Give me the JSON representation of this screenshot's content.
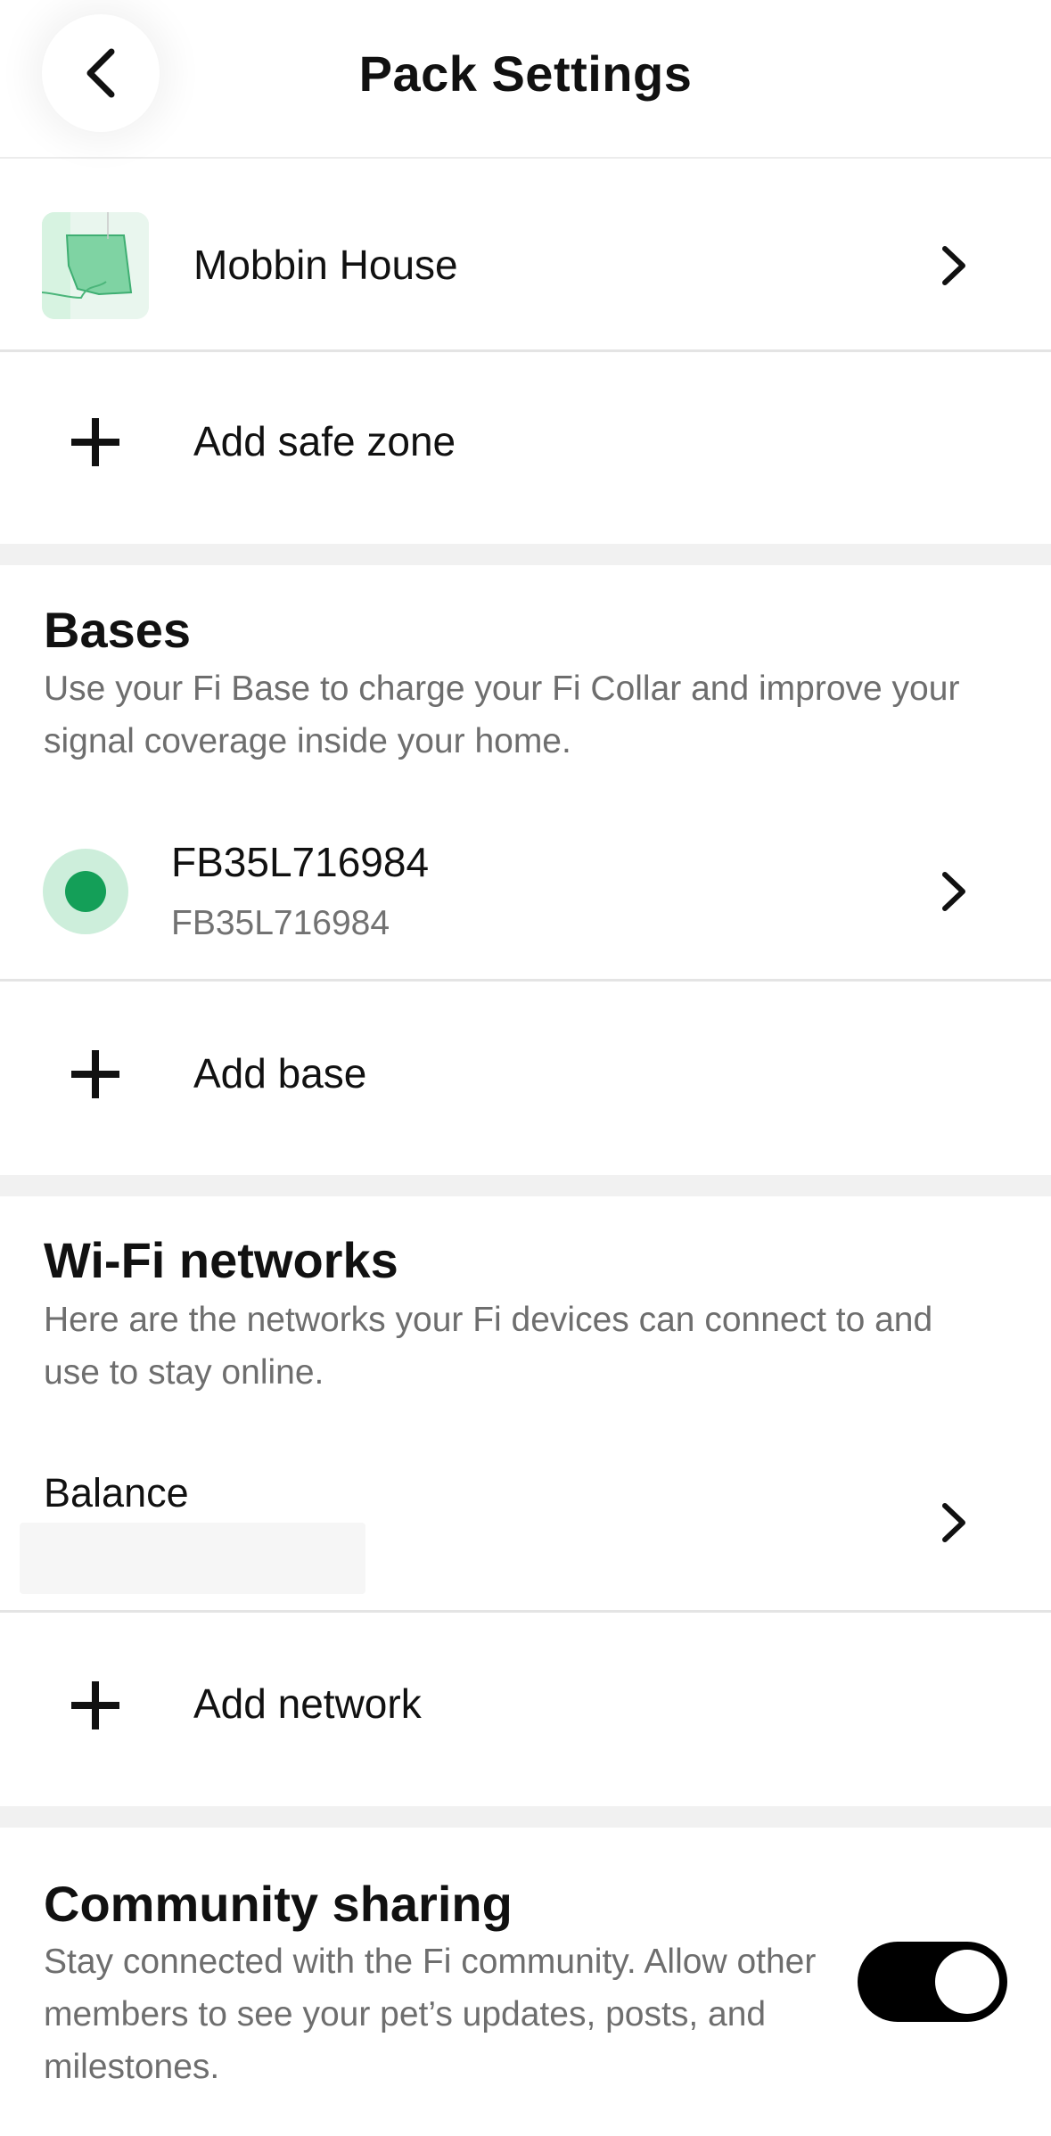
{
  "header": {
    "title": "Pack Settings",
    "back_icon": "chevron-left-icon"
  },
  "safe_zones": {
    "items": [
      {
        "name": "Mobbin House"
      }
    ],
    "add_label": "Add safe zone"
  },
  "bases": {
    "title": "Bases",
    "description": "Use your Fi Base to charge your Fi Collar and improve your signal coverage inside your home.",
    "items": [
      {
        "name": "FB35L716984",
        "subtitle": "FB35L716984",
        "status_color": "#149f58"
      }
    ],
    "add_label": "Add base"
  },
  "wifi": {
    "title": "Wi-Fi networks",
    "description": "Here are the networks your Fi devices can connect to and use to stay online.",
    "items": [
      {
        "name": "Balance"
      }
    ],
    "add_label": "Add network"
  },
  "community": {
    "title": "Community sharing",
    "description": "Stay connected with the Fi community. Allow other members to see your pet’s updates, posts, and milestones.",
    "toggle_on": true
  },
  "colors": {
    "accent_green": "#149f58",
    "toggle_on": "#000000",
    "divider": "#e4e4e4"
  }
}
